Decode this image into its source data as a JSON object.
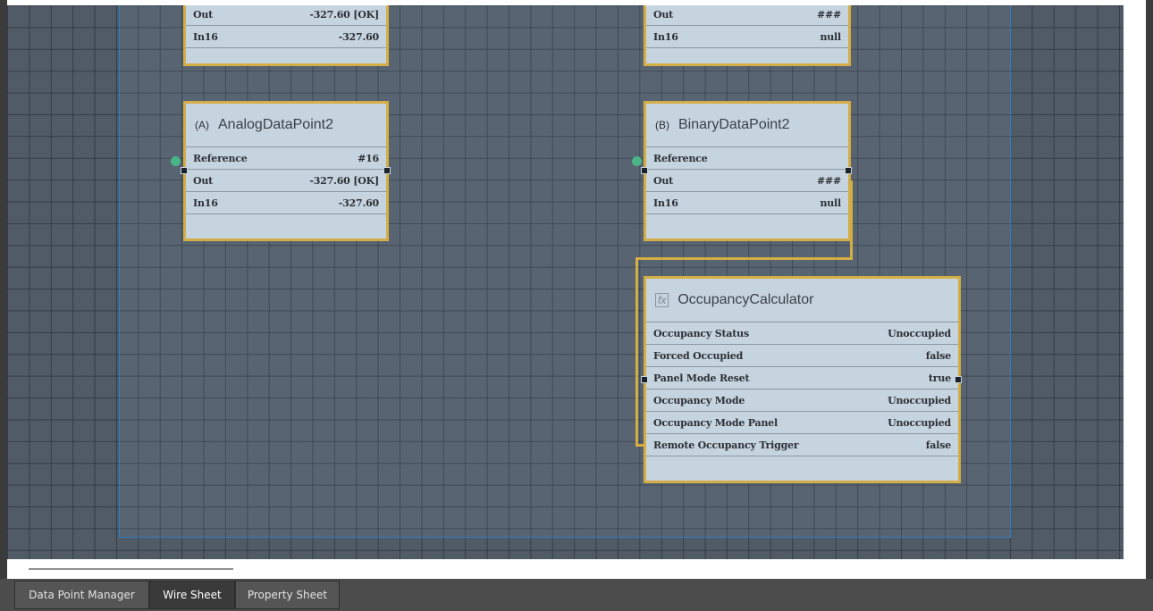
{
  "nodes": {
    "analog_top": {
      "rows": [
        {
          "label": "Out",
          "value": "-327.60 [OK]"
        },
        {
          "label": "In16",
          "value": "-327.60"
        }
      ]
    },
    "binary_top": {
      "rows": [
        {
          "label": "Out",
          "value": "###"
        },
        {
          "label": "In16",
          "value": "null"
        }
      ]
    },
    "analog2": {
      "title": "AnalogDataPoint2",
      "icon": "analog-point-icon",
      "icon_glyph": "(A)",
      "rows": [
        {
          "label": "Reference",
          "value": "#16"
        },
        {
          "label": "Out",
          "value": "-327.60 [OK]"
        },
        {
          "label": "In16",
          "value": "-327.60"
        }
      ]
    },
    "binary2": {
      "title": "BinaryDataPoint2",
      "icon": "binary-point-icon",
      "icon_glyph": "(B)",
      "rows": [
        {
          "label": "Reference",
          "value": ""
        },
        {
          "label": "Out",
          "value": "###"
        },
        {
          "label": "In16",
          "value": "null"
        }
      ]
    },
    "occupancy": {
      "title": "OccupancyCalculator",
      "icon": "function-icon",
      "icon_glyph": "fx",
      "rows": [
        {
          "label": "Occupancy Status",
          "value": "Unoccupied"
        },
        {
          "label": "Forced Occupied",
          "value": "false"
        },
        {
          "label": "Panel Mode Reset",
          "value": "true"
        },
        {
          "label": "Occupancy Mode",
          "value": "Unoccupied"
        },
        {
          "label": "Occupancy Mode Panel",
          "value": "Unoccupied"
        },
        {
          "label": "Remote Occupancy Trigger",
          "value": "false"
        }
      ]
    }
  },
  "tabs": [
    {
      "label": "Data Point Manager",
      "active": false
    },
    {
      "label": "Wire Sheet",
      "active": true
    },
    {
      "label": "Property Sheet",
      "active": false
    }
  ],
  "colors": {
    "canvas": "#515b66",
    "node_border": "#d4ad45",
    "node_fill": "#c6d4e0",
    "selection": "#2f7dc8",
    "connector": "#49b586"
  }
}
